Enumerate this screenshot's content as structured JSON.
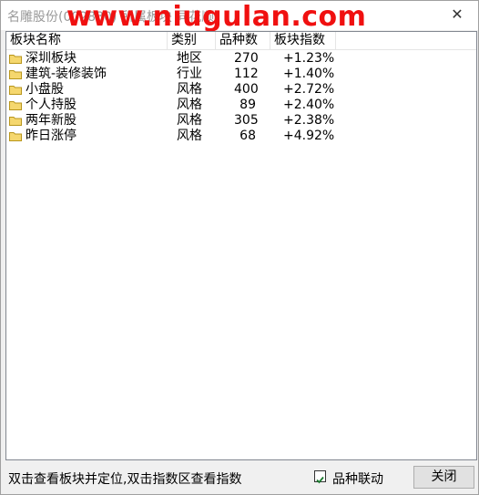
{
  "window": {
    "title": "名雕股份(002830) 所属板块 同花顺",
    "watermark": "www.niugulan.com",
    "close_glyph": "✕"
  },
  "table": {
    "columns": [
      "板块名称",
      "类别",
      "品种数",
      "板块指数"
    ],
    "rows": [
      {
        "name": "深圳板块",
        "category": "地区",
        "count": "270",
        "index": "+1.23%"
      },
      {
        "name": "建筑-装修装饰",
        "category": "行业",
        "count": "112",
        "index": "+1.40%"
      },
      {
        "name": "小盘股",
        "category": "风格",
        "count": "400",
        "index": "+2.72%"
      },
      {
        "name": "个人持股",
        "category": "风格",
        "count": "89",
        "index": "+2.40%"
      },
      {
        "name": "两年新股",
        "category": "风格",
        "count": "305",
        "index": "+2.38%"
      },
      {
        "name": "昨日涨停",
        "category": "风格",
        "count": "68",
        "index": "+4.92%"
      }
    ]
  },
  "footer": {
    "hint": "双击查看板块并定位,双击指数区查看指数",
    "checkbox_label": "品种联动",
    "checkbox_checked": true,
    "close_button": "关闭"
  },
  "colors": {
    "watermark": "#f01010",
    "folder": "#f5d76e",
    "check": "#1a7a2e"
  }
}
